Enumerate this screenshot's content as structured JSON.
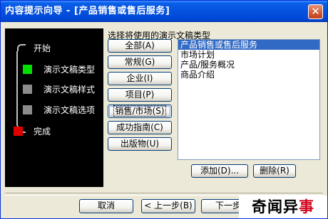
{
  "window": {
    "title": "内容提示向导 - [产品销售或售后服务]",
    "close_glyph": "✕"
  },
  "steps": [
    {
      "label": "开始",
      "color": "#bfbfbf"
    },
    {
      "label": "演示文稿类型",
      "color": "#00e000"
    },
    {
      "label": "演示文稿样式",
      "color": "#8c8c8c"
    },
    {
      "label": "演示文稿选项",
      "color": "#8c8c8c"
    },
    {
      "label": "完成",
      "color": "#e00000"
    }
  ],
  "type_prompt": "选择将使用的演示文稿类型",
  "category_buttons": [
    {
      "label": "全部(A)"
    },
    {
      "label": "常规(G)"
    },
    {
      "label": "企业(I)"
    },
    {
      "label": "项目(P)"
    },
    {
      "label": "销售/市场(S)"
    },
    {
      "label": "成功指南(C)"
    },
    {
      "label": "出版物(U)"
    }
  ],
  "selected_category_index": 4,
  "templates": [
    "产品销售或售后服务",
    "市场计划",
    "产品/服务概况",
    "商品介绍"
  ],
  "selected_template_index": 0,
  "list_actions": {
    "add": "添加(D)...",
    "delete": "删除(R)"
  },
  "footer": {
    "cancel": "取消",
    "back": "< 上一步(B)",
    "next": "下一步"
  },
  "watermark": {
    "main": "奇闻异",
    "accent": "事"
  }
}
